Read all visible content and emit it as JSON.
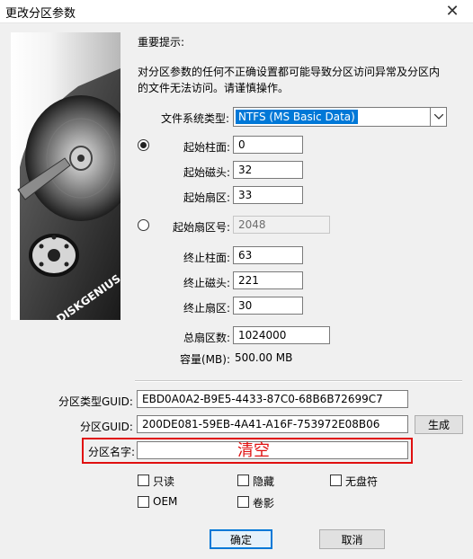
{
  "window": {
    "title": "更改分区参数"
  },
  "warning": {
    "heading": "重要提示:",
    "line1": "对分区参数的任何不正确设置都可能导致分区访问异常及分区内",
    "line2": "的文件无法访问。请谨慎操作。"
  },
  "fs_type": {
    "label": "文件系统类型:",
    "value": "NTFS (MS Basic Data)"
  },
  "start_chs": {
    "cylinder_label": "起始柱面:",
    "cylinder_value": "0",
    "head_label": "起始磁头:",
    "head_value": "32",
    "sector_label": "起始扇区:",
    "sector_value": "33"
  },
  "start_lba": {
    "label": "起始扇区号:",
    "value": "2048"
  },
  "end_chs": {
    "cylinder_label": "终止柱面:",
    "cylinder_value": "63",
    "head_label": "终止磁头:",
    "head_value": "221",
    "sector_label": "终止扇区:",
    "sector_value": "30"
  },
  "total_sectors": {
    "label": "总扇区数:",
    "value": "1024000"
  },
  "capacity": {
    "label": "容量(MB):",
    "value": "500.00 MB"
  },
  "type_guid": {
    "label": "分区类型GUID:",
    "value": "EBD0A0A2-B9E5-4433-87C0-68B6B72699C7"
  },
  "part_guid": {
    "label": "分区GUID:",
    "value": "200DE081-59EB-4A41-A16F-753972E08B06",
    "generate_label": "生成"
  },
  "part_name": {
    "label": "分区名字:",
    "value": "",
    "annotation": "清空"
  },
  "attributes": {
    "readonly": "只读",
    "hidden": "隐藏",
    "no_drive_letter": "无盘符",
    "oem": "OEM",
    "shadow": "卷影"
  },
  "buttons": {
    "ok": "确定",
    "cancel": "取消"
  },
  "brand_text": "DISKGENIUS",
  "icons": {
    "close": "close-icon",
    "dropdown": "chevron-down-icon"
  },
  "colors": {
    "selection": "#0078d7",
    "highlight": "#e01010"
  }
}
